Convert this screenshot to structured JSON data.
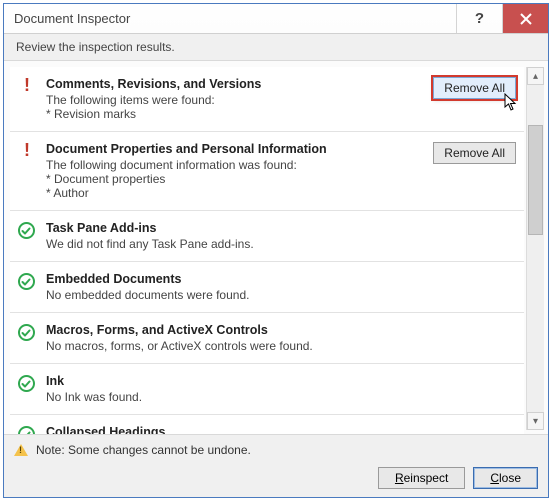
{
  "window": {
    "title": "Document Inspector"
  },
  "subheader": "Review the inspection results.",
  "sections": [
    {
      "status": "warn",
      "title": "Comments, Revisions, and Versions",
      "desc": "The following items were found:\n* Revision marks",
      "action": "Remove All",
      "highlight": true
    },
    {
      "status": "warn",
      "title": "Document Properties and Personal Information",
      "desc": "The following document information was found:\n* Document properties\n* Author",
      "action": "Remove All",
      "highlight": false
    },
    {
      "status": "ok",
      "title": "Task Pane Add-ins",
      "desc": "We did not find any Task Pane add-ins."
    },
    {
      "status": "ok",
      "title": "Embedded Documents",
      "desc": "No embedded documents were found."
    },
    {
      "status": "ok",
      "title": "Macros, Forms, and ActiveX Controls",
      "desc": "No macros, forms, or ActiveX controls were found."
    },
    {
      "status": "ok",
      "title": "Ink",
      "desc": "No Ink was found."
    },
    {
      "status": "ok",
      "title": "Collapsed Headings",
      "desc": ""
    }
  ],
  "footer": {
    "note": "Note: Some changes cannot be undone.",
    "reinspect_label": "Reinspect",
    "close_label": "Close"
  }
}
